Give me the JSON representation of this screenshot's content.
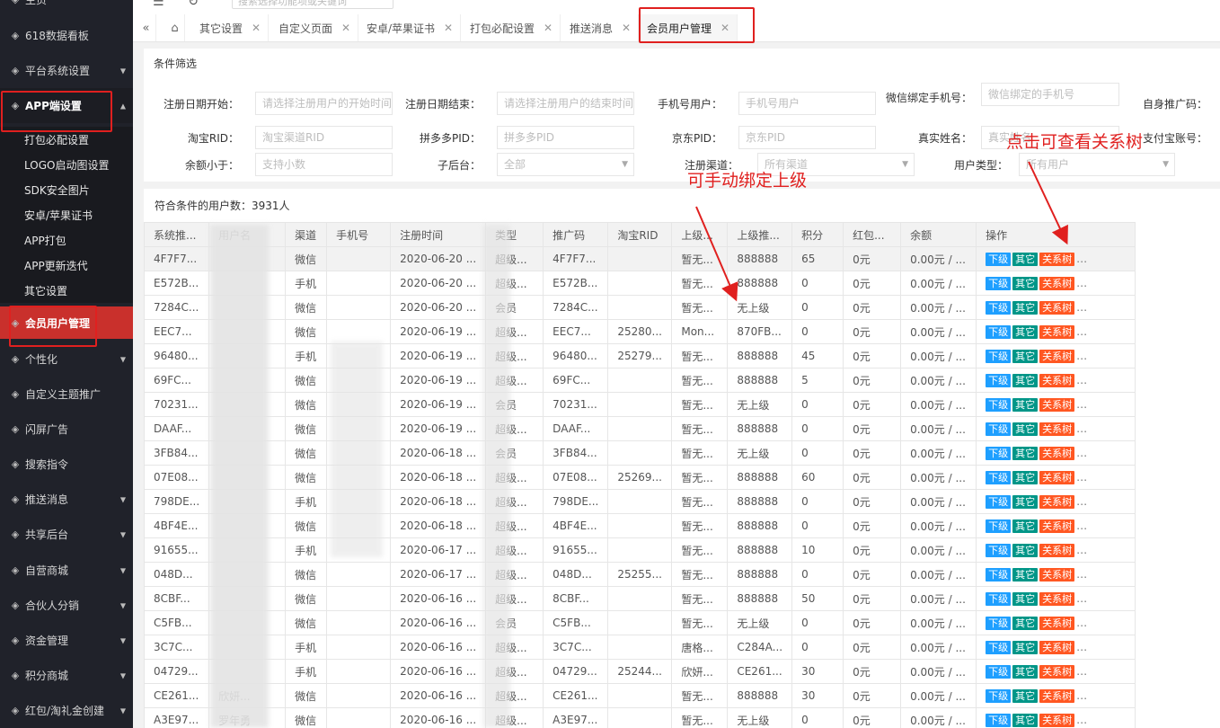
{
  "sidebar": {
    "items": [
      {
        "label": "主页",
        "icon": "home-icon"
      },
      {
        "label": "618数据看板",
        "icon": "cube-icon"
      },
      {
        "label": "平台系统设置",
        "icon": "tools-icon"
      },
      {
        "label": "APP端设置",
        "icon": "gear-icon"
      },
      {
        "label": "会员用户管理",
        "icon": "user-shield-icon"
      },
      {
        "label": "个性化",
        "icon": "palette-icon"
      },
      {
        "label": "自定义主题推广",
        "icon": "cube-icon"
      },
      {
        "label": "闪屏广告",
        "icon": "grid-icon"
      },
      {
        "label": "搜索指令",
        "icon": "grid-icon"
      },
      {
        "label": "推送消息",
        "icon": "user-icon"
      },
      {
        "label": "共享后台",
        "icon": "user-icon"
      },
      {
        "label": "自营商城",
        "icon": "shop-icon"
      },
      {
        "label": "合伙人分销",
        "icon": "layers-icon"
      },
      {
        "label": "资金管理",
        "icon": "money-icon"
      },
      {
        "label": "积分商城",
        "icon": "shield-icon"
      },
      {
        "label": "红包/淘礼金创建",
        "icon": "bell-icon"
      }
    ],
    "sub_items": [
      "打包必配设置",
      "LOGO启动图设置",
      "SDK安全图片",
      "安卓/苹果证书",
      "APP打包",
      "APP更新迭代",
      "其它设置"
    ]
  },
  "topbar": {
    "search_placeholder": "搜索选择功能项或关键词"
  },
  "tabs": [
    {
      "label": "其它设置"
    },
    {
      "label": "自定义页面"
    },
    {
      "label": "安卓/苹果证书"
    },
    {
      "label": "打包必配设置"
    },
    {
      "label": "推送消息"
    },
    {
      "label": "会员用户管理"
    }
  ],
  "filter": {
    "title": "条件筛选",
    "fields": [
      {
        "label": "注册日期开始：",
        "placeholder": "请选择注册用户的开始时间"
      },
      {
        "label": "注册日期结束：",
        "placeholder": "请选择注册用户的结束时间"
      },
      {
        "label": "手机号用户：",
        "placeholder": "手机号用户"
      },
      {
        "label": "微信绑定手机号：",
        "placeholder": "微信绑定的手机号"
      },
      {
        "label": "自身推广码：",
        "placeholder": ""
      },
      {
        "label": "淘宝RID：",
        "placeholder": "淘宝渠道RID"
      },
      {
        "label": "拼多多PID：",
        "placeholder": "拼多多PID"
      },
      {
        "label": "京东PID：",
        "placeholder": "京东PID"
      },
      {
        "label": "真实姓名：",
        "placeholder": "真实姓名"
      },
      {
        "label": "支付宝账号：",
        "placeholder": ""
      },
      {
        "label": "余额小于：",
        "placeholder": "支持小数"
      },
      {
        "label": "子后台：",
        "placeholder": "全部"
      },
      {
        "label": "注册渠道：",
        "placeholder": "所有渠道"
      },
      {
        "label": "用户类型：",
        "placeholder": "所有用户"
      }
    ]
  },
  "result": {
    "count_text": "符合条件的用户数：3931人",
    "columns": [
      "系统推...",
      "用户名",
      "渠道",
      "手机号",
      "注册时间",
      "类型",
      "推广码",
      "淘宝RID",
      "上级...",
      "上级推...",
      "积分",
      "红包...",
      "余额",
      "操作"
    ],
    "op_labels": {
      "sub": "下级",
      "other": "其它",
      "tree": "关系树"
    },
    "rows": [
      [
        "4F7F7...",
        "",
        "微信",
        "",
        "2020-06-20 ...",
        "超级...",
        "4F7F7...",
        "",
        "暂无...",
        "888888",
        "65",
        "0元",
        "0.00元 / ..."
      ],
      [
        "E572B...",
        "",
        "手机",
        "",
        "2020-06-20 ...",
        "超级...",
        "E572B...",
        "",
        "暂无...",
        "888888",
        "0",
        "0元",
        "0.00元 / ..."
      ],
      [
        "7284C...",
        "",
        "微信",
        "",
        "2020-06-20 ...",
        "会员",
        "7284C...",
        "",
        "暂无...",
        "无上级",
        "0",
        "0元",
        "0.00元 / ..."
      ],
      [
        "EEC7...",
        "",
        "微信",
        "",
        "2020-06-19 ...",
        "超级...",
        "EEC7...",
        "25280...",
        "Mon...",
        "870FB...",
        "0",
        "0元",
        "0.00元 / ..."
      ],
      [
        "96480...",
        "",
        "手机",
        "",
        "2020-06-19 ...",
        "超级...",
        "96480...",
        "25279...",
        "暂无...",
        "888888",
        "45",
        "0元",
        "0.00元 / ..."
      ],
      [
        "69FC...",
        "",
        "微信",
        "",
        "2020-06-19 ...",
        "超级...",
        "69FC...",
        "",
        "暂无...",
        "888888",
        "5",
        "0元",
        "0.00元 / ..."
      ],
      [
        "70231...",
        "",
        "微信",
        "",
        "2020-06-19 ...",
        "会员",
        "70231...",
        "",
        "暂无...",
        "无上级",
        "0",
        "0元",
        "0.00元 / ..."
      ],
      [
        "DAAF...",
        "",
        "微信",
        "",
        "2020-06-19 ...",
        "超级...",
        "DAAF...",
        "",
        "暂无...",
        "888888",
        "0",
        "0元",
        "0.00元 / ..."
      ],
      [
        "3FB84...",
        "",
        "微信",
        "",
        "2020-06-18 ...",
        "会员",
        "3FB84...",
        "",
        "暂无...",
        "无上级",
        "0",
        "0元",
        "0.00元 / ..."
      ],
      [
        "07E08...",
        "",
        "微信",
        "",
        "2020-06-18 ...",
        "超级...",
        "07E08...",
        "25269...",
        "暂无...",
        "888888",
        "60",
        "0元",
        "0.00元 / ..."
      ],
      [
        "798DE...",
        "",
        "手机",
        "",
        "2020-06-18 ...",
        "超级...",
        "798DE...",
        "",
        "暂无...",
        "888888",
        "0",
        "0元",
        "0.00元 / ..."
      ],
      [
        "4BF4E...",
        "",
        "微信",
        "",
        "2020-06-18 ...",
        "超级...",
        "4BF4E...",
        "",
        "暂无...",
        "888888",
        "0",
        "0元",
        "0.00元 / ..."
      ],
      [
        "91655...",
        "",
        "手机",
        "",
        "2020-06-17 ...",
        "超级...",
        "91655...",
        "",
        "暂无...",
        "888888",
        "10",
        "0元",
        "0.00元 / ..."
      ],
      [
        "048D...",
        "",
        "微信",
        "",
        "2020-06-17 ...",
        "超级...",
        "048D...",
        "25255...",
        "暂无...",
        "888888",
        "0",
        "0元",
        "0.00元 / ..."
      ],
      [
        "8CBF...",
        "",
        "微信",
        "",
        "2020-06-16 ...",
        "超级...",
        "8CBF...",
        "",
        "暂无...",
        "888888",
        "50",
        "0元",
        "0.00元 / ..."
      ],
      [
        "C5FB...",
        "",
        "微信",
        "",
        "2020-06-16 ...",
        "会员",
        "C5FB...",
        "",
        "暂无...",
        "无上级",
        "0",
        "0元",
        "0.00元 / ..."
      ],
      [
        "3C7C...",
        "",
        "手机",
        "",
        "2020-06-16 ...",
        "超级...",
        "3C7C...",
        "",
        "唐格...",
        "C284A...",
        "0",
        "0元",
        "0.00元 / ..."
      ],
      [
        "04729...",
        "",
        "手机",
        "",
        "2020-06-16 ...",
        "超级...",
        "04729...",
        "25244...",
        "欣妍...",
        "CE261...",
        "30",
        "0元",
        "0.00元 / ..."
      ],
      [
        "CE261...",
        "欣妍...",
        "微信",
        "",
        "2020-06-16 ...",
        "超级...",
        "CE261...",
        "",
        "暂无...",
        "888888",
        "30",
        "0元",
        "0.00元 / ..."
      ],
      [
        "A3E97...",
        "罗年勇",
        "微信",
        "",
        "2020-06-16 ...",
        "超级...",
        "A3E97...",
        "",
        "暂无...",
        "无上级",
        "0",
        "0元",
        "0.00元 / ..."
      ]
    ]
  },
  "annotations": {
    "bind_parent": "可手动绑定上级",
    "view_tree": "点击可查看关系树"
  },
  "colors": {
    "sidebar_bg": "#20222a",
    "active_red": "#c9302c",
    "annotation_red": "#e0201f",
    "btn_blue": "#1e9fff",
    "btn_green": "#009688",
    "btn_orange": "#ff5722"
  }
}
